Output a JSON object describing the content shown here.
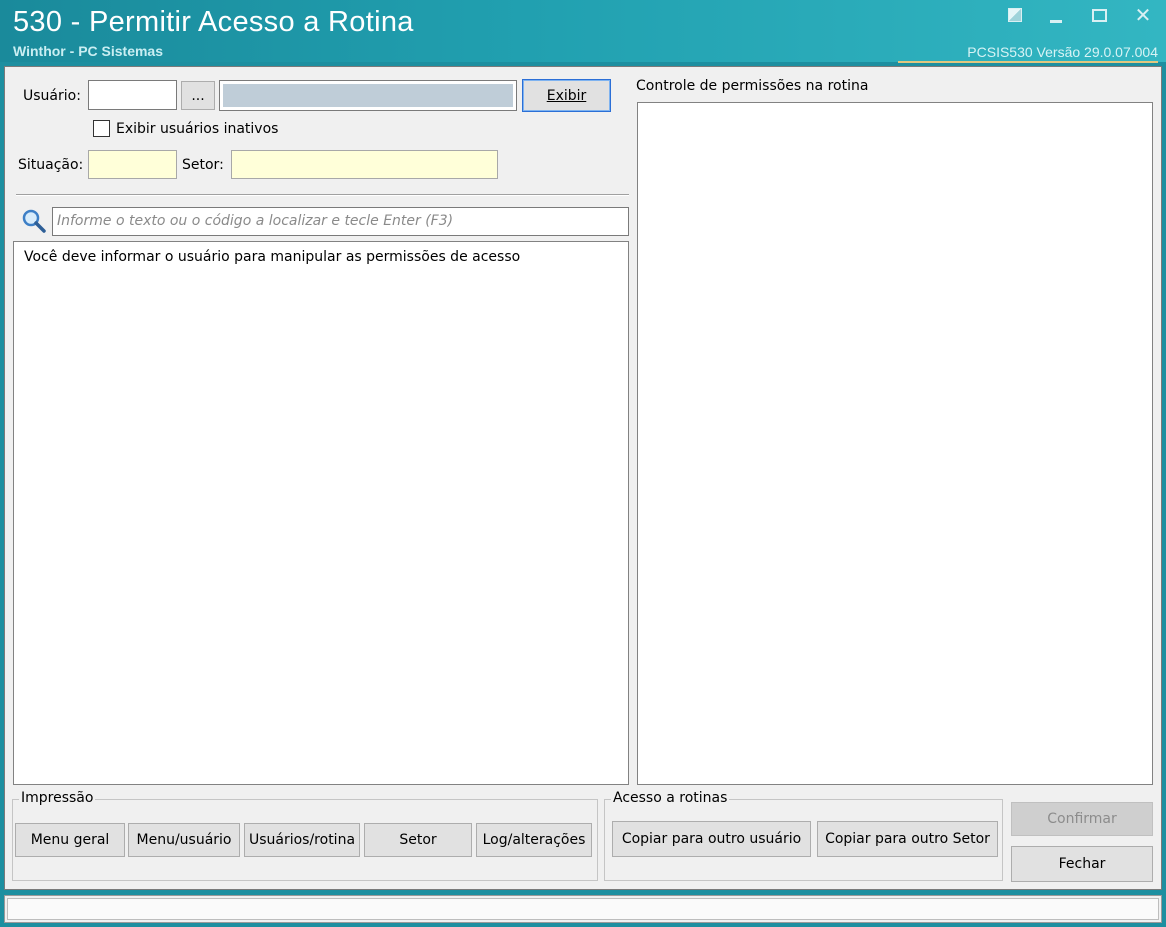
{
  "window": {
    "title": "530 - Permitir Acesso a Rotina",
    "subtitle": "Winthor - PC Sistemas",
    "version": "PCSIS530  Versão  29.0.07.004"
  },
  "user_panel": {
    "usuario_label": "Usuário:",
    "usuario_code_value": "",
    "browse_label": "...",
    "usuario_name_value": "",
    "exibir_label": "Exibir",
    "inactive_label": "Exibir usuários inativos",
    "situacao_label": "Situação:",
    "situacao_value": "",
    "setor_label": "Setor:",
    "setor_value": ""
  },
  "search": {
    "placeholder": "Informe o texto ou o código a localizar e tecle Enter (F3)"
  },
  "list": {
    "message": "Você deve informar o usuário para manipular as permissões de acesso"
  },
  "permissions": {
    "title": "Controle de permissões na rotina"
  },
  "impressao": {
    "legend": "Impressão",
    "buttons": [
      "Menu geral",
      "Menu/usuário",
      "Usuários/rotina",
      "Setor",
      "Log/alterações"
    ]
  },
  "acesso": {
    "legend": "Acesso a rotinas",
    "copy_user": "Copiar para outro usuário",
    "copy_setor": "Copiar para outro Setor"
  },
  "actions": {
    "confirmar": "Confirmar",
    "fechar": "Fechar"
  },
  "colors": {
    "titlebar": "#1d8fa0",
    "readonly_field": "#ffffd9",
    "name_field": "#bfcdd8"
  }
}
